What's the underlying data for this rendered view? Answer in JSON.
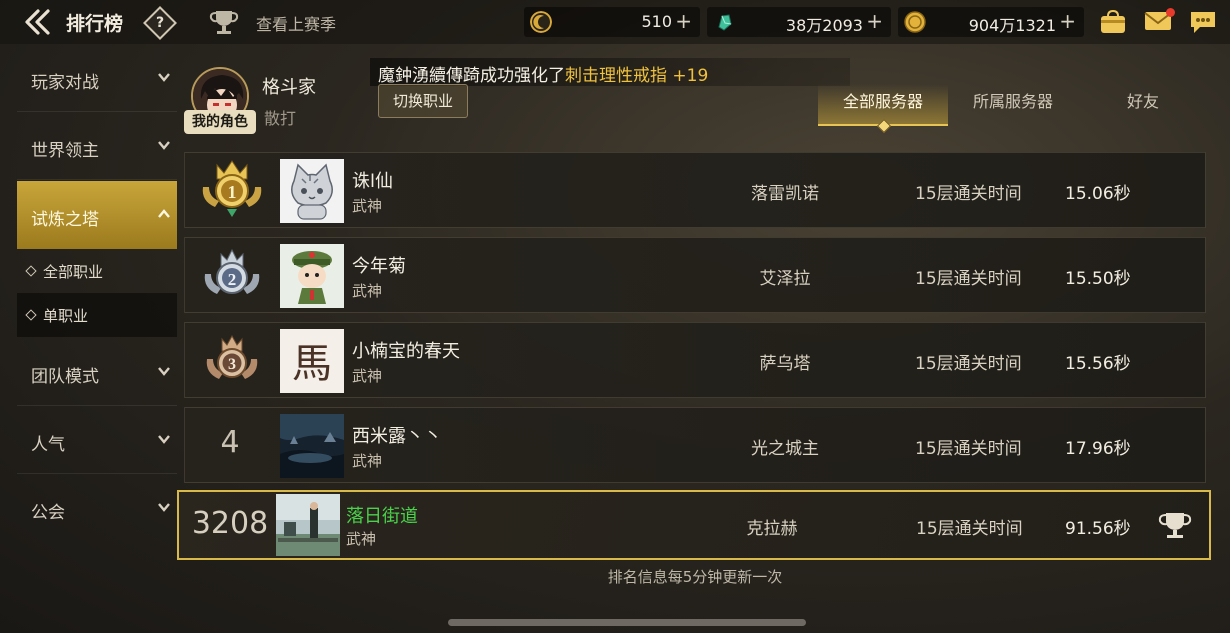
{
  "header": {
    "title": "排行榜",
    "help_icon": "help-diamond-icon",
    "help_label": "?",
    "season_link": "查看上赛季",
    "currencies": [
      {
        "icon": "crescent-coin-icon",
        "value": "510",
        "plus": "+",
        "color": "#d9a93a"
      },
      {
        "icon": "green-crystal-icon",
        "value": "38万2093",
        "plus": "+",
        "color": "#3fbf9a"
      },
      {
        "icon": "gold-coin-icon",
        "value": "904万1321",
        "plus": "+",
        "color": "#e2b23a"
      }
    ]
  },
  "sidebar": {
    "items": [
      {
        "label": "玩家对战",
        "expanded": false
      },
      {
        "label": "世界领主",
        "expanded": false
      },
      {
        "label": "试炼之塔",
        "expanded": true,
        "active": true
      },
      {
        "label": "团队模式",
        "expanded": false
      },
      {
        "label": "人气",
        "expanded": false
      },
      {
        "label": "公会",
        "expanded": false
      }
    ],
    "sub_items": [
      {
        "label": "全部职业",
        "selected": false
      },
      {
        "label": "单职业",
        "selected": true
      }
    ]
  },
  "profile": {
    "name": "格斗家",
    "class": "散打",
    "badge": "我的角色",
    "switch_button": "切换职业"
  },
  "notice": {
    "prefix": "魔鈡湧續傳踦成功强化了",
    "item": "刺击理性戒指 +19"
  },
  "tabs": [
    {
      "label": "全部服务器",
      "active": true
    },
    {
      "label": "所属服务器",
      "active": false
    },
    {
      "label": "好友",
      "active": false
    }
  ],
  "rankings": [
    {
      "rank": "1",
      "name": "诛l仙",
      "class": "武神",
      "server": "落雷凯诺",
      "metric": "15层通关时间",
      "time": "15.06秒"
    },
    {
      "rank": "2",
      "name": "今年菊",
      "class": "武神",
      "server": "艾泽拉",
      "metric": "15层通关时间",
      "time": "15.50秒"
    },
    {
      "rank": "3",
      "name": "小楠宝的春天",
      "class": "武神",
      "server": "萨乌塔",
      "metric": "15层通关时间",
      "time": "15.56秒"
    },
    {
      "rank": "4",
      "name": "西米露丶丶",
      "class": "武神",
      "server": "光之城主",
      "metric": "15层通关时间",
      "time": "17.96秒"
    }
  ],
  "my_rank": {
    "rank": "3208",
    "name": "落日街道",
    "class": "武神",
    "server": "克拉赫",
    "metric": "15层通关时间",
    "time": "91.56秒"
  },
  "footer_note": "排名信息每5分钟更新一次",
  "avatar3_char": "馬"
}
